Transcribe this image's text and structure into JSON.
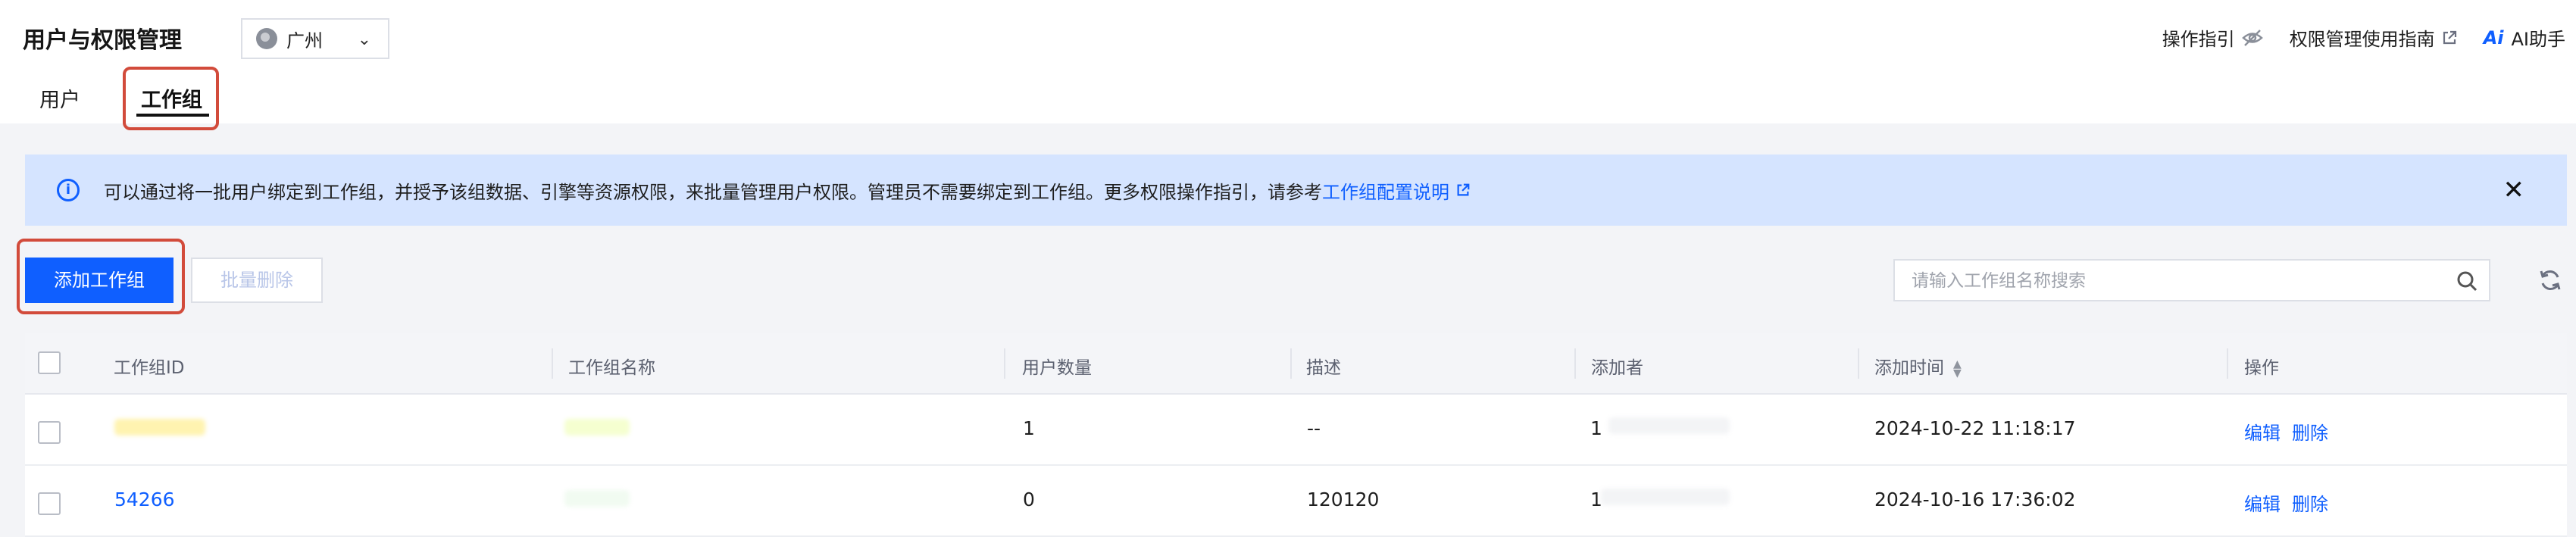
{
  "header": {
    "title": "用户与权限管理",
    "region": "广州",
    "links": {
      "guide": "操作指引",
      "perm_guide": "权限管理使用指南",
      "ai_mark": "Ai",
      "ai": "AI助手"
    }
  },
  "tabs": [
    {
      "label": "用户"
    },
    {
      "label": "工作组",
      "active": true
    }
  ],
  "banner": {
    "text": "可以通过将一批用户绑定到工作组，并授予该组数据、引擎等资源权限，来批量管理用户权限。管理员不需要绑定到工作组。更多权限操作指引，请参考",
    "link": "工作组配置说明"
  },
  "toolbar": {
    "add_label": "添加工作组",
    "batch_delete_label": "批量删除",
    "search_placeholder": "请输入工作组名称搜索"
  },
  "table": {
    "columns": [
      "工作组ID",
      "工作组名称",
      "用户数量",
      "描述",
      "添加者",
      "添加时间",
      "操作"
    ],
    "rows": [
      {
        "id": "",
        "name": "",
        "users": "1",
        "desc": "--",
        "creator": "1",
        "time": "2024-10-22 11:18:17",
        "ops": [
          "编辑",
          "删除"
        ]
      },
      {
        "id": "54266",
        "name": "",
        "users": "0",
        "desc": "120120",
        "creator": "1",
        "time": "2024-10-16 17:36:02",
        "ops": [
          "编辑",
          "删除"
        ]
      }
    ]
  },
  "colors": {
    "primary": "#0f5fff",
    "banner_bg": "#d5e4ff",
    "highlight": "#d24b3b"
  }
}
